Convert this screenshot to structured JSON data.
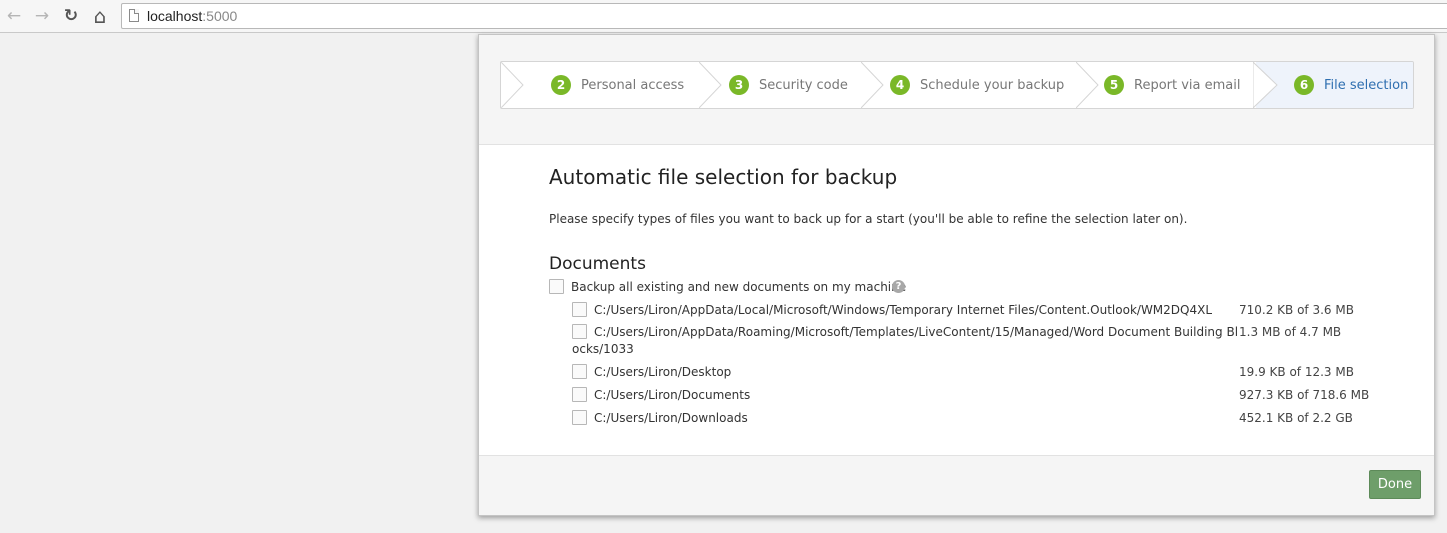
{
  "browser": {
    "back_icon": "←",
    "forward_icon": "→",
    "reload_icon": "↻",
    "home_icon": "⌂",
    "host": "localhost",
    "port": ":5000"
  },
  "wizard": {
    "steps": [
      {
        "number": "2",
        "label": "Personal access"
      },
      {
        "number": "3",
        "label": "Security code"
      },
      {
        "number": "4",
        "label": "Schedule your backup"
      },
      {
        "number": "5",
        "label": "Report via email"
      },
      {
        "number": "6",
        "label": "File selection"
      }
    ],
    "active_step": "6"
  },
  "main": {
    "title": "Automatic file selection for backup",
    "intro": "Please specify types of files you want to back up for a start (you'll be able to refine the selection later on).",
    "group_title": "Documents",
    "all_option": "Backup all existing and new documents on my machine",
    "help_icon": "?",
    "folders": [
      {
        "path": "C:/Users/Liron/AppData/Local/Microsoft/Windows/Temporary Internet Files/Content.Outlook/WM2DQ4XL",
        "size": "710.2 KB of 3.6 MB"
      },
      {
        "path_line1": "C:/Users/Liron/AppData/Roaming/Microsoft/Templates/LiveContent/15/Managed/Word Document Building Bl",
        "path_line2": "ocks/1033",
        "size": "1.3 MB of 4.7 MB"
      },
      {
        "path": "C:/Users/Liron/Desktop",
        "size": "19.9 KB of 12.3 MB"
      },
      {
        "path": "C:/Users/Liron/Documents",
        "size": "927.3 KB of 718.6 MB"
      },
      {
        "path": "C:/Users/Liron/Downloads",
        "size": "452.1 KB of 2.2 GB"
      }
    ]
  },
  "footer": {
    "done_label": "Done"
  },
  "colors": {
    "step_badge": "#7ab828",
    "active_step_text": "#2f6fb0",
    "done_button": "#6e9e6a"
  }
}
